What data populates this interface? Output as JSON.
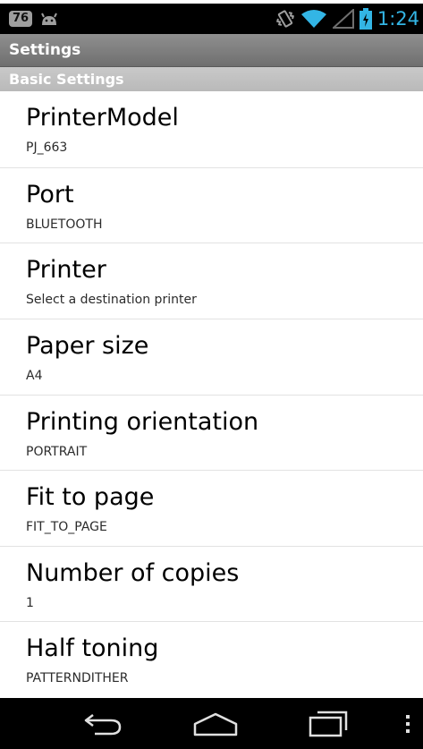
{
  "status_bar": {
    "notification_count": "76",
    "clock": "1:24",
    "colors": {
      "accent": "#33b5e5",
      "background": "#000000"
    },
    "icons": [
      "notification-badge",
      "android-debug-icon",
      "vibrate-icon",
      "wifi-icon",
      "signal-icon",
      "battery-charging-icon"
    ]
  },
  "title_bar": {
    "title": "Settings"
  },
  "category": {
    "title": "Basic Settings"
  },
  "preferences": [
    {
      "title": "PrinterModel",
      "summary": "PJ_663"
    },
    {
      "title": "Port",
      "summary": "BLUETOOTH"
    },
    {
      "title": "Printer",
      "summary": "Select a destination printer"
    },
    {
      "title": "Paper size",
      "summary": "A4"
    },
    {
      "title": "Printing orientation",
      "summary": "PORTRAIT"
    },
    {
      "title": "Fit to page",
      "summary": "FIT_TO_PAGE"
    },
    {
      "title": "Number of copies",
      "summary": "1"
    },
    {
      "title": "Half toning",
      "summary": "PATTERNDITHER"
    }
  ],
  "nav_bar": {
    "icons": [
      "back-icon",
      "home-icon",
      "recent-apps-icon",
      "overflow-menu-icon"
    ]
  }
}
